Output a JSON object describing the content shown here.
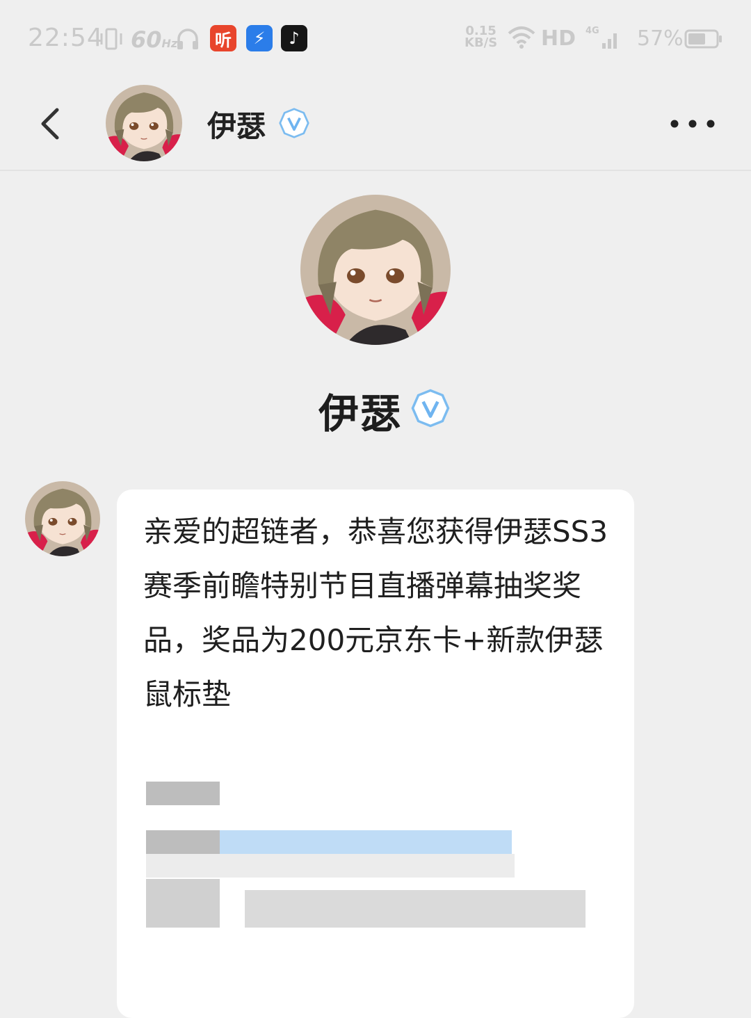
{
  "status_bar": {
    "time": "22:54",
    "refresh_rate": "60",
    "refresh_unit": "Hz",
    "net_speed_value": "0.15",
    "net_speed_unit": "KB/S",
    "network_hd": "HD",
    "network_type": "4G",
    "battery_percent": "57%",
    "app_icons": [
      "听",
      "⚡",
      "♪"
    ]
  },
  "header": {
    "name": "伊瑟",
    "verified_icon": "verified-v-icon",
    "accent_color": "#6fb4f0"
  },
  "profile": {
    "name": "伊瑟"
  },
  "message": {
    "text": "亲爱的超链者，恭喜您获得伊瑟SS3赛季前瞻特别节目直播弹幕抽奖奖品，奖品为200元京东卡+新款伊瑟鼠标垫"
  }
}
